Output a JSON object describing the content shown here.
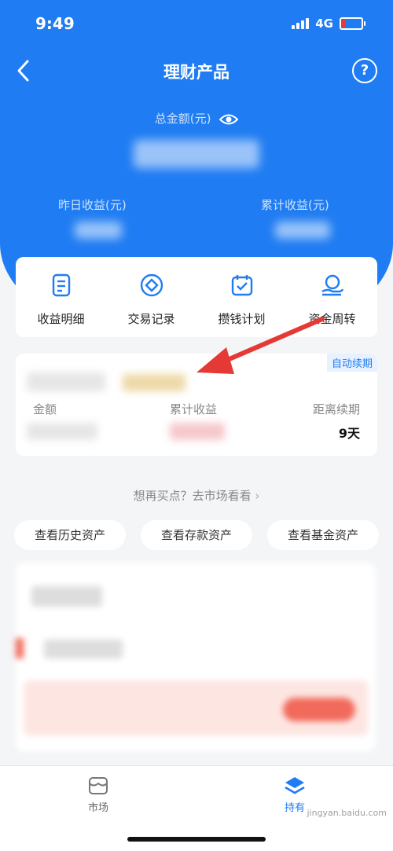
{
  "status": {
    "time": "9:49",
    "network": "4G"
  },
  "nav": {
    "title": "理财产品",
    "help": "?"
  },
  "summary": {
    "total_label": "总金额(元)",
    "yesterday_label": "昨日收益(元)",
    "cumulative_label": "累计收益(元)"
  },
  "quick_actions": [
    {
      "label": "收益明细",
      "icon": "receipt-icon"
    },
    {
      "label": "交易记录",
      "icon": "exchange-icon"
    },
    {
      "label": "攒钱计划",
      "icon": "calendar-check-icon"
    },
    {
      "label": "资金周转",
      "icon": "hand-coin-icon"
    }
  ],
  "product": {
    "tag": "自动续期",
    "amount_label": "金额",
    "income_label": "累计收益",
    "renew_label": "距离续期",
    "renew_value": "9天"
  },
  "market_prompt": "想再买点？去市场看看",
  "history_buttons": [
    "查看历史资产",
    "查看存款资产",
    "查看基金资产"
  ],
  "tabbar": {
    "market": "市场",
    "holdings": "持有"
  },
  "watermark": "jingyan.baidu.com",
  "colors": {
    "primary": "#1f7cf2",
    "annotation_arrow": "#e53935"
  }
}
